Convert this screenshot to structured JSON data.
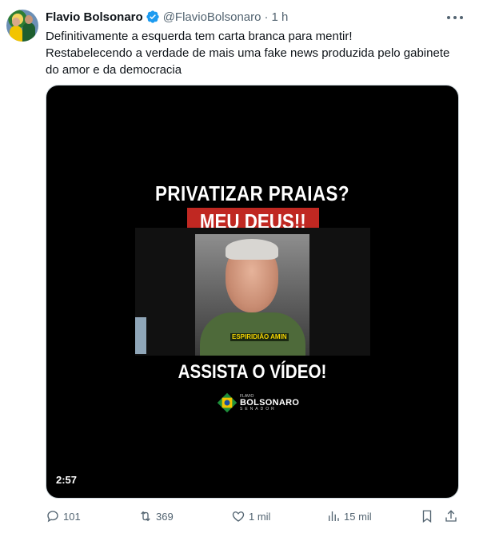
{
  "author": {
    "name": "Flavio Bolsonaro",
    "handle": "@FlavioBolsonaro",
    "separator": "·",
    "time": "1 h",
    "verified_color": "#1d9bf0"
  },
  "tweet": {
    "lines": [
      "Definitivamente a esquerda tem carta branca para mentir!",
      "Restabelecendo a verdade de mais uma fake news produzida pelo gabinete",
      "do amor e da democracia"
    ]
  },
  "video": {
    "headline1": "PRIVATIZAR PRAIAS?",
    "headline2": "MEU DEUS!!",
    "caption": "ESPIRIDIÃO AMIN",
    "headline3": "ASSISTA O VÍDEO!",
    "logo": {
      "small": "FLAVIO",
      "big": "BOLSONARO",
      "sub": "SENADOR"
    },
    "duration": "2:57",
    "accent_color": "#c02822"
  },
  "actions": {
    "replies": "101",
    "reposts": "369",
    "likes": "1 mil",
    "views": "15 mil"
  },
  "icons": {
    "verified": "verified-badge-icon",
    "more": "more-options-icon",
    "reply": "reply-icon",
    "repost": "repost-icon",
    "like": "heart-icon",
    "views": "views-chart-icon",
    "bookmark": "bookmark-icon",
    "share": "share-icon"
  }
}
